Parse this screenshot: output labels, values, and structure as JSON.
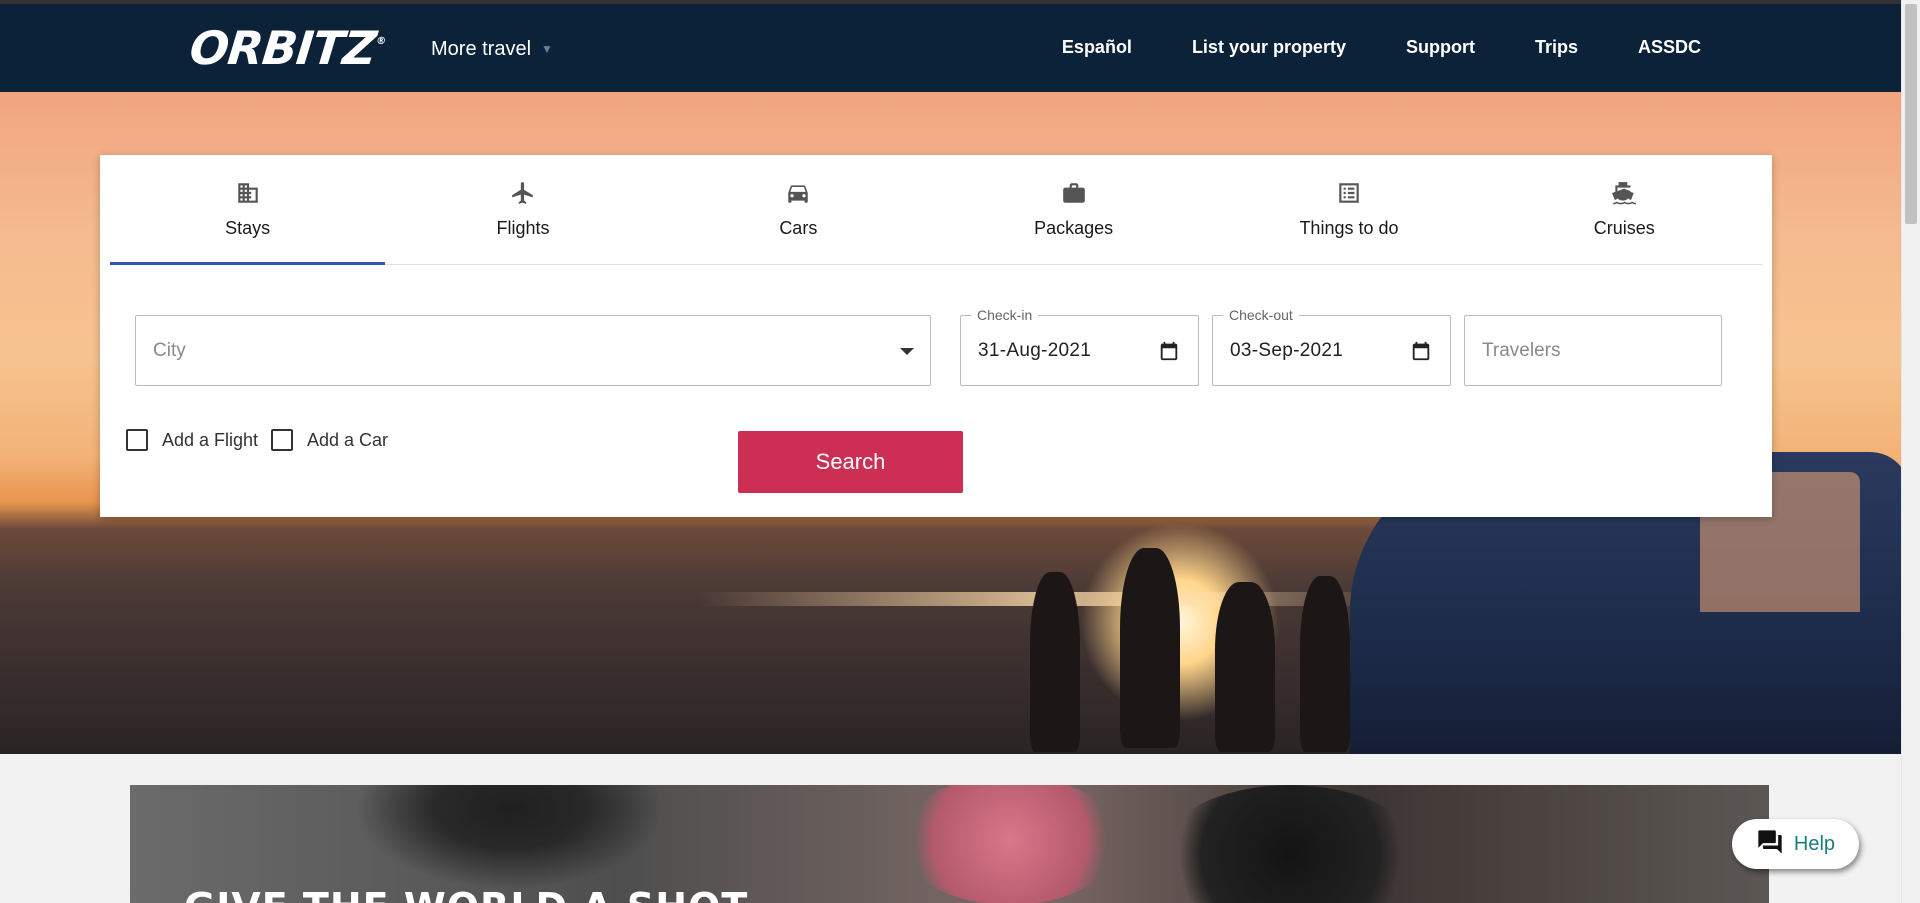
{
  "header": {
    "logo": "ORBITZ",
    "logo_mark": "®",
    "more_travel": "More travel",
    "nav": [
      "Español",
      "List your property",
      "Support",
      "Trips",
      "ASSDC"
    ]
  },
  "tabs": [
    {
      "label": "Stays",
      "icon": "building-icon",
      "active": true
    },
    {
      "label": "Flights",
      "icon": "airplane-icon",
      "active": false
    },
    {
      "label": "Cars",
      "icon": "car-icon",
      "active": false
    },
    {
      "label": "Packages",
      "icon": "suitcase-icon",
      "active": false
    },
    {
      "label": "Things to do",
      "icon": "list-icon",
      "active": false
    },
    {
      "label": "Cruises",
      "icon": "ship-icon",
      "active": false
    }
  ],
  "search": {
    "city_placeholder": "City",
    "checkin_label": "Check-in",
    "checkin_value": "31-Aug-2021",
    "checkout_label": "Check-out",
    "checkout_value": "03-Sep-2021",
    "travelers_placeholder": "Travelers",
    "add_flight": "Add a Flight",
    "add_car": "Add a Car",
    "search_button": "Search"
  },
  "promo": {
    "title": "GIVE THE WORLD A SHOT"
  },
  "help": {
    "label": "Help"
  },
  "colors": {
    "header_bg": "#0b2239",
    "accent_tab": "#3155b5",
    "search_button": "#cd2e54",
    "help_text": "#1a7d7d"
  }
}
